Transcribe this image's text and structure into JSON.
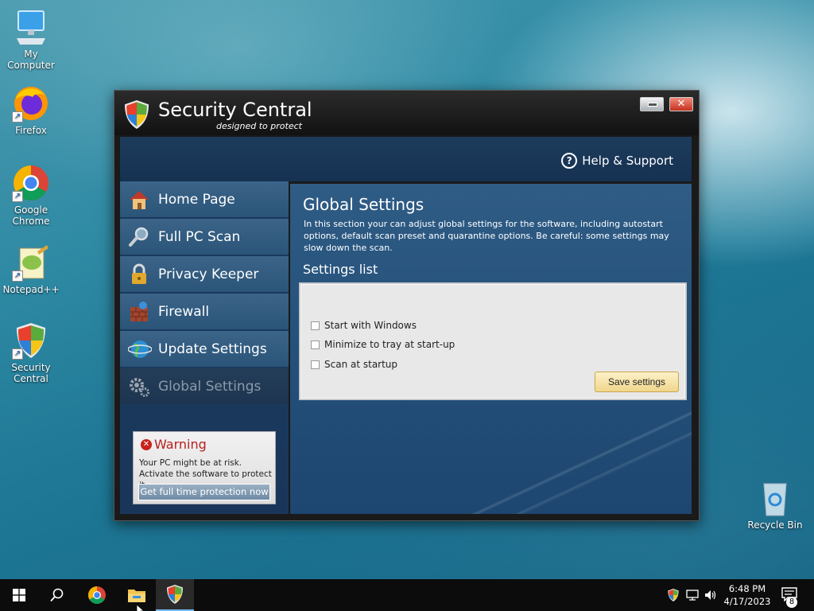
{
  "desktop": {
    "icons": [
      {
        "label": "My Computer"
      },
      {
        "label": "Firefox"
      },
      {
        "label": "Google Chrome"
      },
      {
        "label": "Notepad++"
      },
      {
        "label": "Security Central"
      },
      {
        "label": "Recycle Bin"
      }
    ]
  },
  "window": {
    "title": "Security Central",
    "tagline": "designed to protect",
    "help_label": "Help & Support",
    "nav": [
      {
        "label": "Home Page",
        "icon": "house-icon"
      },
      {
        "label": "Full PC Scan",
        "icon": "magnifier-icon"
      },
      {
        "label": "Privacy Keeper",
        "icon": "padlock-icon"
      },
      {
        "label": "Firewall",
        "icon": "brick-wall-icon"
      },
      {
        "label": "Update Settings",
        "icon": "globe-icon"
      },
      {
        "label": "Global Settings",
        "icon": "gears-icon"
      }
    ],
    "warning": {
      "title": "Warning",
      "line1": "Your PC might be at risk.",
      "line2": "Activate the software to protect it.",
      "button": "Get full time protection now"
    },
    "main": {
      "title": "Global Settings",
      "description": "In this section your can adjust global settings for the software, including autostart options, default scan preset and quarantine options. Be careful: some settings may slow down the scan.",
      "settings_heading": "Settings list",
      "options": [
        {
          "label": "Start with Windows",
          "checked": false
        },
        {
          "label": "Minimize to tray at start-up",
          "checked": false
        },
        {
          "label": "Scan at startup",
          "checked": false
        }
      ],
      "save_label": "Save settings"
    }
  },
  "taskbar": {
    "time": "6:48 PM",
    "date": "4/17/2023",
    "notification_count": "8"
  },
  "colors": {
    "warning_red": "#c9231f",
    "nav_blue": "#3b6488",
    "save_button": "#f0d68c"
  }
}
